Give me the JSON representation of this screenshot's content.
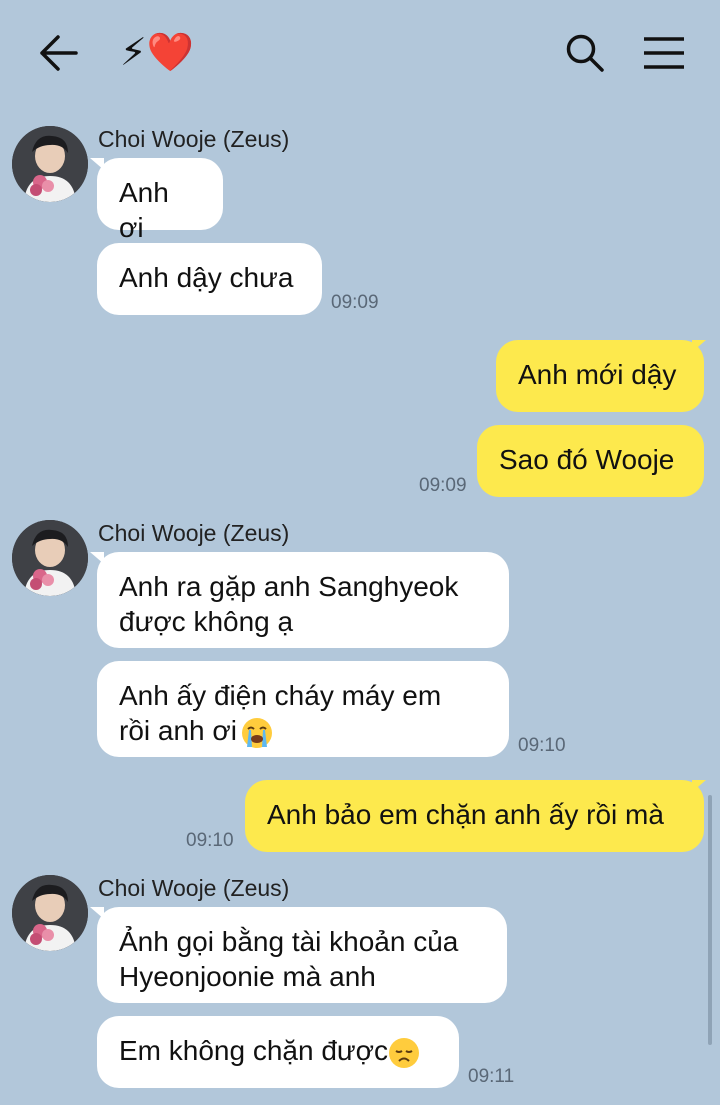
{
  "header": {
    "title": "⚡❤️",
    "back_icon": "arrow-left-icon",
    "search_icon": "search-icon",
    "menu_icon": "hamburger-menu-icon"
  },
  "colors": {
    "background": "#b2c7da",
    "incoming_bubble": "#ffffff",
    "outgoing_bubble": "#fde94d",
    "timestamp": "#5a6877"
  },
  "messages": {
    "g1": {
      "sender": "Choi Wooje (Zeus)",
      "m1": "Anh ơi",
      "m2": "Anh dậy chưa",
      "time": "09:09"
    },
    "g2": {
      "m1": "Anh mới dậy",
      "m2": "Sao đó Wooje",
      "time": "09:09"
    },
    "g3": {
      "sender": "Choi Wooje (Zeus)",
      "m1": "Anh ra gặp anh Sanghyeok\nđược không ạ",
      "m2_text": "Anh ấy điện cháy máy em\nrồi anh ơi",
      "m2_emoji": "loudly-crying-face-emoji",
      "time": "09:10"
    },
    "g4": {
      "m1": "Anh bảo em chặn anh ấy rồi mà",
      "time": "09:10"
    },
    "g5": {
      "sender": "Choi Wooje (Zeus)",
      "m1": "Ảnh gọi bằng tài khoản của\nHyeonjoonie mà anh",
      "m2_text": "Em không chặn được",
      "m2_emoji": "disappointed-face-emoji",
      "time": "09:11"
    }
  }
}
